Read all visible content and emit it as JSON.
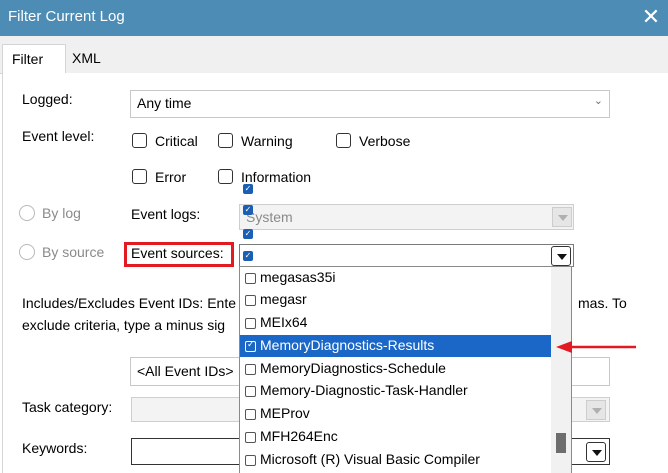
{
  "window": {
    "title": "Filter Current Log",
    "close_glyph": "✕"
  },
  "tabs": [
    {
      "label": "Filter"
    },
    {
      "label": "XML"
    }
  ],
  "logged": {
    "label": "Logged:",
    "value": "Any time"
  },
  "event_level": {
    "label": "Event level:",
    "options": [
      {
        "label": "Critical",
        "checked": false
      },
      {
        "label": "Warning",
        "checked": false
      },
      {
        "label": "Verbose",
        "checked": false
      },
      {
        "label": "Error",
        "checked": false
      },
      {
        "label": "Information",
        "checked": false
      }
    ]
  },
  "scope": {
    "by_log": "By log",
    "by_source": "By source",
    "event_logs_label": "Event logs:",
    "event_logs_value": "System",
    "event_sources_label": "Event sources:"
  },
  "event_ids": {
    "description_left": "Includes/Excludes Event IDs: Ente",
    "description_right": "mas. To",
    "description_line2": "exclude criteria, type a minus sig",
    "value": "<All Event IDs>"
  },
  "task_category": {
    "label": "Task category:"
  },
  "keywords": {
    "label": "Keywords:"
  },
  "event_sources_list": {
    "selected": "MemoryDiagnostics-Results",
    "items": [
      {
        "label": "megasas35i",
        "checked": false
      },
      {
        "label": "megasr",
        "checked": false
      },
      {
        "label": "MEIx64",
        "checked": false
      },
      {
        "label": "MemoryDiagnostics-Results",
        "checked": true
      },
      {
        "label": "MemoryDiagnostics-Schedule",
        "checked": false
      },
      {
        "label": "Memory-Diagnostic-Task-Handler",
        "checked": false
      },
      {
        "label": "MEProv",
        "checked": false
      },
      {
        "label": "MFH264Enc",
        "checked": false
      },
      {
        "label": "Microsoft (R) Visual Basic Compiler",
        "checked": false
      }
    ]
  },
  "colors": {
    "titlebar": "#4d8cb5",
    "selection": "#1a67c7",
    "highlight": "#e21b22"
  }
}
